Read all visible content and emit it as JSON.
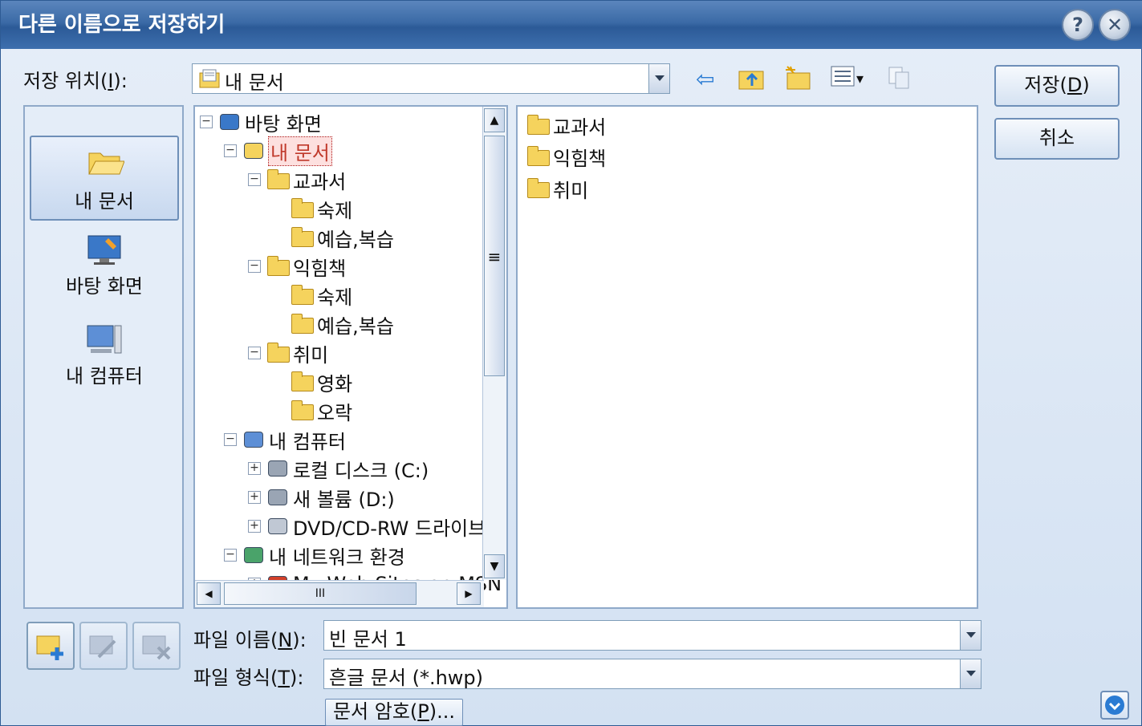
{
  "window": {
    "title": "다른 이름으로 저장하기",
    "help_glyph": "?",
    "close_glyph": "✕"
  },
  "location": {
    "label_prefix": "저장 위치(",
    "label_key": "I",
    "label_suffix": "):",
    "value": "내 문서"
  },
  "toolbar": {
    "back_glyph": "⇦",
    "views_arrow": "▾"
  },
  "places": [
    {
      "label": "내 문서",
      "icon": "folder-open-icon"
    },
    {
      "label": "바탕 화면",
      "icon": "desktop-icon"
    },
    {
      "label": "내 컴퓨터",
      "icon": "computer-icon"
    }
  ],
  "tree": {
    "items": [
      {
        "label": "바탕 화면",
        "toggle": "⊟",
        "icon": "desktop"
      },
      {
        "label": "내 문서",
        "toggle": "⊟",
        "icon": "mydocs"
      },
      {
        "label": "교과서",
        "toggle": "⊟",
        "icon": "folder"
      },
      {
        "label": "숙제",
        "toggle": "",
        "icon": "folder"
      },
      {
        "label": "예습,복습",
        "toggle": "",
        "icon": "folder"
      },
      {
        "label": "익힘책",
        "toggle": "⊟",
        "icon": "folder"
      },
      {
        "label": "숙제",
        "toggle": "",
        "icon": "folder"
      },
      {
        "label": "예습,복습",
        "toggle": "",
        "icon": "folder"
      },
      {
        "label": "취미",
        "toggle": "⊟",
        "icon": "folder"
      },
      {
        "label": "영화",
        "toggle": "",
        "icon": "folder"
      },
      {
        "label": "오락",
        "toggle": "",
        "icon": "folder"
      },
      {
        "label": "내 컴퓨터",
        "toggle": "⊟",
        "icon": "computer"
      },
      {
        "label": "로컬 디스크 (C:)",
        "toggle": "⊞",
        "icon": "drive"
      },
      {
        "label": "새 볼륨 (D:)",
        "toggle": "⊞",
        "icon": "drive"
      },
      {
        "label": "DVD/CD-RW 드라이브",
        "toggle": "⊞",
        "icon": "dvd"
      },
      {
        "label": "내 네트워크 환경",
        "toggle": "⊟",
        "icon": "network"
      },
      {
        "label": "My Web Sites on MSN",
        "toggle": "⊞",
        "icon": "web"
      }
    ],
    "scroll_grip": "≡",
    "hscroll_grip": "III",
    "up_arrow": "▲",
    "down_arrow": "▼",
    "left_arrow": "◀",
    "right_arrow": "▶"
  },
  "files": [
    {
      "label": "교과서"
    },
    {
      "label": "익힘책"
    },
    {
      "label": "취미"
    }
  ],
  "filename": {
    "label_prefix": "파일 이름(",
    "label_key": "N",
    "label_suffix": "):",
    "value": "빈 문서 1"
  },
  "filetype": {
    "label_prefix": "파일 형식(",
    "label_key": "T",
    "label_suffix": "):",
    "value": "흔글 문서 (*.hwp)"
  },
  "buttons": {
    "save_prefix": "저장(",
    "save_key": "D",
    "save_suffix": ")",
    "cancel": "취소",
    "password_prefix": "문서 암호(",
    "password_key": "P",
    "password_suffix": ")..."
  },
  "colors": {
    "title_bar": "#3b6aa6",
    "selected_tree_text": "#c0392b",
    "folder": "#f5d35d"
  }
}
